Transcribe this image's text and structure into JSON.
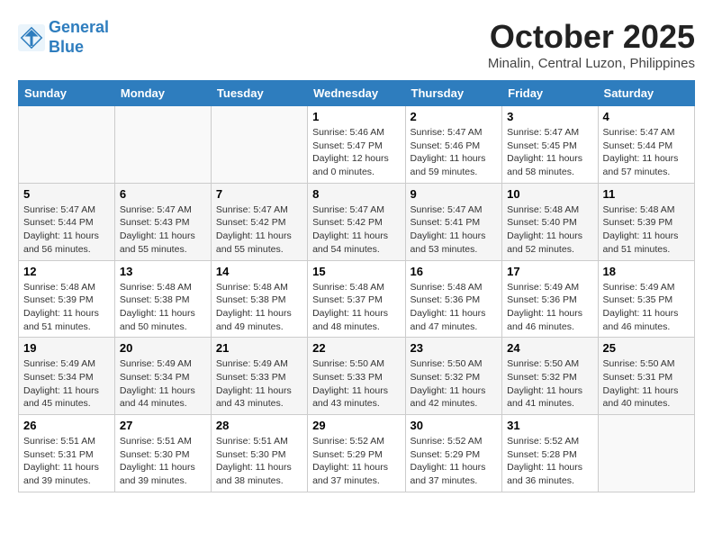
{
  "logo": {
    "line1": "General",
    "line2": "Blue"
  },
  "title": "October 2025",
  "location": "Minalin, Central Luzon, Philippines",
  "weekdays": [
    "Sunday",
    "Monday",
    "Tuesday",
    "Wednesday",
    "Thursday",
    "Friday",
    "Saturday"
  ],
  "weeks": [
    [
      {
        "day": "",
        "sunrise": "",
        "sunset": "",
        "daylight": ""
      },
      {
        "day": "",
        "sunrise": "",
        "sunset": "",
        "daylight": ""
      },
      {
        "day": "",
        "sunrise": "",
        "sunset": "",
        "daylight": ""
      },
      {
        "day": "1",
        "sunrise": "Sunrise: 5:46 AM",
        "sunset": "Sunset: 5:47 PM",
        "daylight": "Daylight: 12 hours and 0 minutes."
      },
      {
        "day": "2",
        "sunrise": "Sunrise: 5:47 AM",
        "sunset": "Sunset: 5:46 PM",
        "daylight": "Daylight: 11 hours and 59 minutes."
      },
      {
        "day": "3",
        "sunrise": "Sunrise: 5:47 AM",
        "sunset": "Sunset: 5:45 PM",
        "daylight": "Daylight: 11 hours and 58 minutes."
      },
      {
        "day": "4",
        "sunrise": "Sunrise: 5:47 AM",
        "sunset": "Sunset: 5:44 PM",
        "daylight": "Daylight: 11 hours and 57 minutes."
      }
    ],
    [
      {
        "day": "5",
        "sunrise": "Sunrise: 5:47 AM",
        "sunset": "Sunset: 5:44 PM",
        "daylight": "Daylight: 11 hours and 56 minutes."
      },
      {
        "day": "6",
        "sunrise": "Sunrise: 5:47 AM",
        "sunset": "Sunset: 5:43 PM",
        "daylight": "Daylight: 11 hours and 55 minutes."
      },
      {
        "day": "7",
        "sunrise": "Sunrise: 5:47 AM",
        "sunset": "Sunset: 5:42 PM",
        "daylight": "Daylight: 11 hours and 55 minutes."
      },
      {
        "day": "8",
        "sunrise": "Sunrise: 5:47 AM",
        "sunset": "Sunset: 5:42 PM",
        "daylight": "Daylight: 11 hours and 54 minutes."
      },
      {
        "day": "9",
        "sunrise": "Sunrise: 5:47 AM",
        "sunset": "Sunset: 5:41 PM",
        "daylight": "Daylight: 11 hours and 53 minutes."
      },
      {
        "day": "10",
        "sunrise": "Sunrise: 5:48 AM",
        "sunset": "Sunset: 5:40 PM",
        "daylight": "Daylight: 11 hours and 52 minutes."
      },
      {
        "day": "11",
        "sunrise": "Sunrise: 5:48 AM",
        "sunset": "Sunset: 5:39 PM",
        "daylight": "Daylight: 11 hours and 51 minutes."
      }
    ],
    [
      {
        "day": "12",
        "sunrise": "Sunrise: 5:48 AM",
        "sunset": "Sunset: 5:39 PM",
        "daylight": "Daylight: 11 hours and 51 minutes."
      },
      {
        "day": "13",
        "sunrise": "Sunrise: 5:48 AM",
        "sunset": "Sunset: 5:38 PM",
        "daylight": "Daylight: 11 hours and 50 minutes."
      },
      {
        "day": "14",
        "sunrise": "Sunrise: 5:48 AM",
        "sunset": "Sunset: 5:38 PM",
        "daylight": "Daylight: 11 hours and 49 minutes."
      },
      {
        "day": "15",
        "sunrise": "Sunrise: 5:48 AM",
        "sunset": "Sunset: 5:37 PM",
        "daylight": "Daylight: 11 hours and 48 minutes."
      },
      {
        "day": "16",
        "sunrise": "Sunrise: 5:48 AM",
        "sunset": "Sunset: 5:36 PM",
        "daylight": "Daylight: 11 hours and 47 minutes."
      },
      {
        "day": "17",
        "sunrise": "Sunrise: 5:49 AM",
        "sunset": "Sunset: 5:36 PM",
        "daylight": "Daylight: 11 hours and 46 minutes."
      },
      {
        "day": "18",
        "sunrise": "Sunrise: 5:49 AM",
        "sunset": "Sunset: 5:35 PM",
        "daylight": "Daylight: 11 hours and 46 minutes."
      }
    ],
    [
      {
        "day": "19",
        "sunrise": "Sunrise: 5:49 AM",
        "sunset": "Sunset: 5:34 PM",
        "daylight": "Daylight: 11 hours and 45 minutes."
      },
      {
        "day": "20",
        "sunrise": "Sunrise: 5:49 AM",
        "sunset": "Sunset: 5:34 PM",
        "daylight": "Daylight: 11 hours and 44 minutes."
      },
      {
        "day": "21",
        "sunrise": "Sunrise: 5:49 AM",
        "sunset": "Sunset: 5:33 PM",
        "daylight": "Daylight: 11 hours and 43 minutes."
      },
      {
        "day": "22",
        "sunrise": "Sunrise: 5:50 AM",
        "sunset": "Sunset: 5:33 PM",
        "daylight": "Daylight: 11 hours and 43 minutes."
      },
      {
        "day": "23",
        "sunrise": "Sunrise: 5:50 AM",
        "sunset": "Sunset: 5:32 PM",
        "daylight": "Daylight: 11 hours and 42 minutes."
      },
      {
        "day": "24",
        "sunrise": "Sunrise: 5:50 AM",
        "sunset": "Sunset: 5:32 PM",
        "daylight": "Daylight: 11 hours and 41 minutes."
      },
      {
        "day": "25",
        "sunrise": "Sunrise: 5:50 AM",
        "sunset": "Sunset: 5:31 PM",
        "daylight": "Daylight: 11 hours and 40 minutes."
      }
    ],
    [
      {
        "day": "26",
        "sunrise": "Sunrise: 5:51 AM",
        "sunset": "Sunset: 5:31 PM",
        "daylight": "Daylight: 11 hours and 39 minutes."
      },
      {
        "day": "27",
        "sunrise": "Sunrise: 5:51 AM",
        "sunset": "Sunset: 5:30 PM",
        "daylight": "Daylight: 11 hours and 39 minutes."
      },
      {
        "day": "28",
        "sunrise": "Sunrise: 5:51 AM",
        "sunset": "Sunset: 5:30 PM",
        "daylight": "Daylight: 11 hours and 38 minutes."
      },
      {
        "day": "29",
        "sunrise": "Sunrise: 5:52 AM",
        "sunset": "Sunset: 5:29 PM",
        "daylight": "Daylight: 11 hours and 37 minutes."
      },
      {
        "day": "30",
        "sunrise": "Sunrise: 5:52 AM",
        "sunset": "Sunset: 5:29 PM",
        "daylight": "Daylight: 11 hours and 37 minutes."
      },
      {
        "day": "31",
        "sunrise": "Sunrise: 5:52 AM",
        "sunset": "Sunset: 5:28 PM",
        "daylight": "Daylight: 11 hours and 36 minutes."
      },
      {
        "day": "",
        "sunrise": "",
        "sunset": "",
        "daylight": ""
      }
    ]
  ]
}
